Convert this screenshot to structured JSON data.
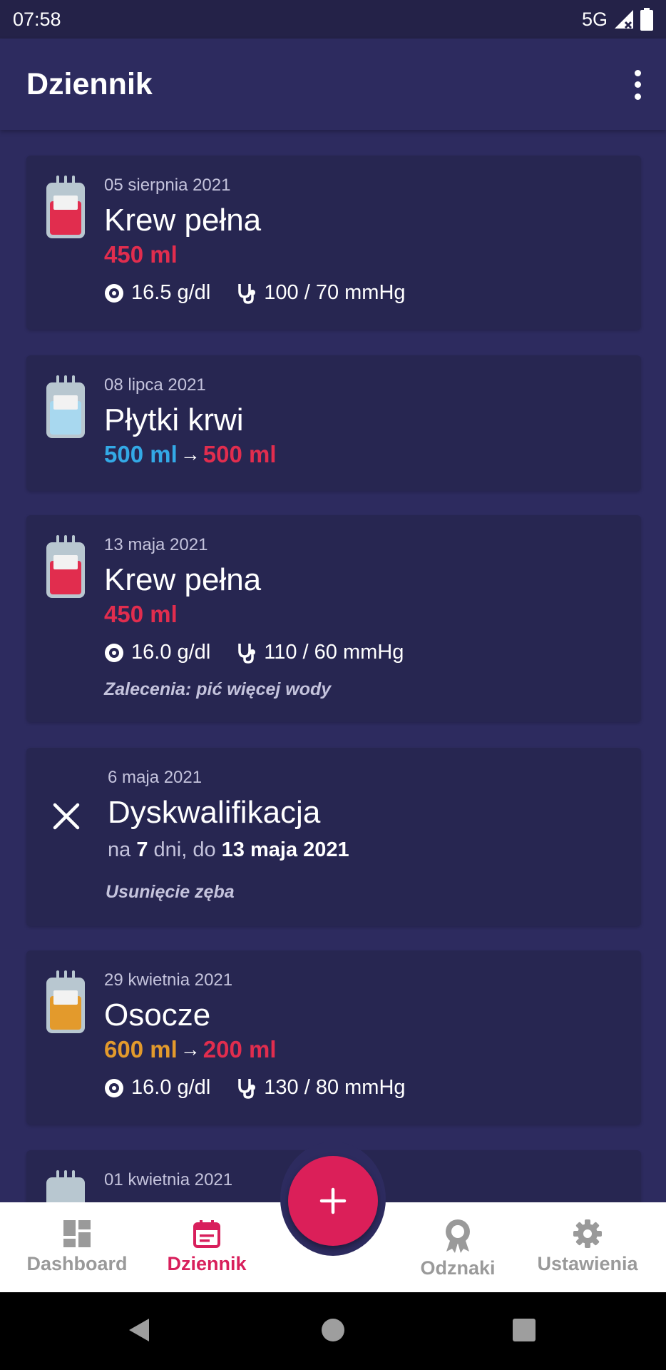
{
  "status_bar": {
    "time": "07:58",
    "network": "5G"
  },
  "app_bar": {
    "title": "Dziennik",
    "menu_icon": "more-vertical-icon"
  },
  "colors": {
    "accent": "#db1f59",
    "background": "#2d2b5f",
    "card": "#272651",
    "red": "#e12d4e",
    "blue": "#33a9e6",
    "orange": "#e39a2c"
  },
  "entries": [
    {
      "date": "05 sierpnia 2021",
      "title": "Krew pełna",
      "volume": "450 ml",
      "hemoglobin": "16.5 g/dl",
      "pressure": "100 / 70 mmHg",
      "bag_icon": "blood-bag-icon",
      "bag_color": "#e12d4e"
    },
    {
      "date": "08 lipca 2021",
      "title": "Płytki krwi",
      "volume_from": "500 ml",
      "volume_to": "500 ml",
      "bag_icon": "blood-bag-icon",
      "bag_color": "#a8d8ef"
    },
    {
      "date": "13 maja 2021",
      "title": "Krew pełna",
      "volume": "450 ml",
      "hemoglobin": "16.0 g/dl",
      "pressure": "110 / 60 mmHg",
      "note": "Zalecenia: pić więcej wody",
      "bag_icon": "blood-bag-icon",
      "bag_color": "#e12d4e"
    },
    {
      "date": "6 maja 2021",
      "title": "Dyskwalifikacja",
      "detail_prefix": "na",
      "detail_days": "7",
      "detail_middle": "dni, do",
      "detail_until": "13 maja 2021",
      "note": "Usunięcie zęba",
      "icon": "close-icon"
    },
    {
      "date": "29 kwietnia 2021",
      "title": "Osocze",
      "volume_from": "600 ml",
      "volume_to": "200 ml",
      "hemoglobin": "16.0 g/dl",
      "pressure": "130 / 80 mmHg",
      "bag_icon": "blood-bag-icon",
      "bag_color": "#e39a2c"
    },
    {
      "date": "01 kwietnia 2021",
      "bag_icon": "blood-bag-icon"
    }
  ],
  "nav": {
    "items": [
      {
        "label": "Dashboard",
        "icon": "dashboard-icon",
        "active": false
      },
      {
        "label": "Dziennik",
        "icon": "calendar-icon",
        "active": true
      },
      {
        "label": "Odznaki",
        "icon": "badge-icon",
        "active": false
      },
      {
        "label": "Ustawienia",
        "icon": "gear-icon",
        "active": false
      }
    ],
    "fab_icon": "plus-icon"
  }
}
